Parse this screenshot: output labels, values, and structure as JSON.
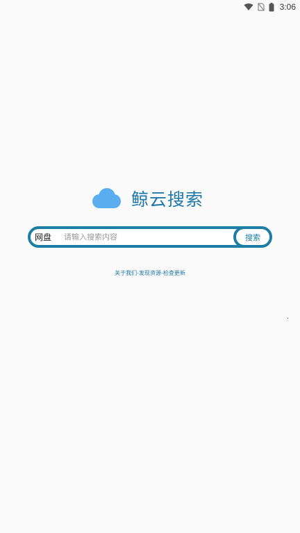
{
  "status_bar": {
    "time": "3:06",
    "icons": [
      "wifi-icon",
      "no-sim-icon",
      "battery-icon"
    ]
  },
  "logo": {
    "title": "鲸云搜索",
    "icon": "cloud-icon",
    "color": "#1f78a8",
    "cloud_color": "#5aaef0"
  },
  "search": {
    "type_label": "网盘",
    "placeholder": "请输入搜索内容",
    "value": "",
    "button_label": "搜索",
    "border_color": "#1d7ea5"
  },
  "links": {
    "about": "关于我们",
    "discover": "发现资源",
    "update": "检查更新",
    "separator": "-"
  }
}
